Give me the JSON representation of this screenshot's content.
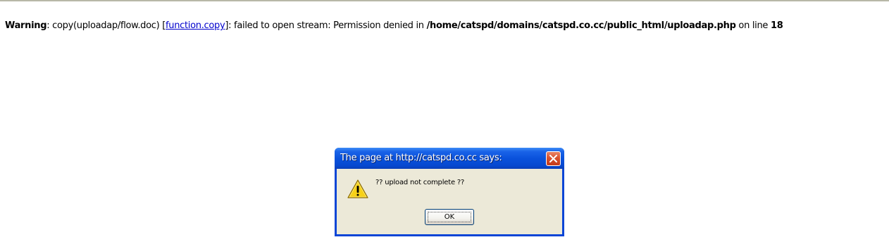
{
  "page": {
    "warning": {
      "label": "Warning",
      "text_before_link": ": copy(uploadap/flow.doc) [",
      "link_text": "function.copy",
      "text_after_link": "]: failed to open stream: Permission denied in ",
      "file_path": "/home/catspd/domains/catspd.co.cc/public_html/uploadap.php",
      "line_prefix": " on line ",
      "line_number": "18"
    }
  },
  "dialog": {
    "title": "The page at http://catspd.co.cc says:",
    "message": "?? upload not complete ??",
    "ok_label": "OK",
    "icon": "warning-icon",
    "close_icon": "close-icon"
  },
  "colors": {
    "link": "#0000cc",
    "titlebar": "#0a52dc",
    "close_button": "#d8512e",
    "dialog_face": "#ece9d8"
  }
}
